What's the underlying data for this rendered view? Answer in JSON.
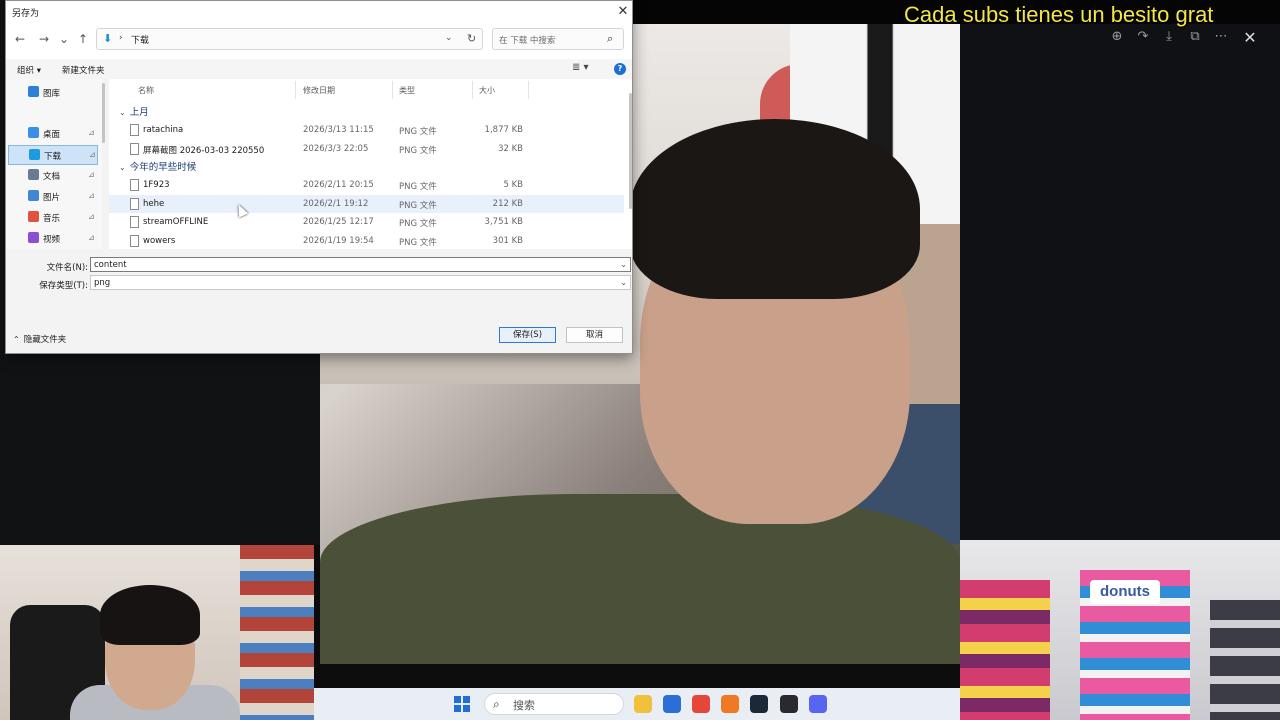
{
  "overlay": {
    "text": "Cada subs tienes un besito grat"
  },
  "dialog": {
    "title": "另存为",
    "close_glyph": "✕",
    "nav": {
      "back": "←",
      "forward": "→",
      "recent": "⌄",
      "up": "↑"
    },
    "address": {
      "icon": "⬇",
      "separator": "›",
      "path": "下载",
      "dropdown": "⌄",
      "refresh": "↻"
    },
    "search": {
      "placeholder": "在 下载 中搜索",
      "icon": "⌕"
    },
    "commands": {
      "organize": "组织 ▾",
      "new_folder": "新建文件夹",
      "view": "≣ ▾",
      "help": "?"
    },
    "nav_pane": {
      "items": [
        {
          "label": "图库",
          "color": "#2d7fd8",
          "pinned": false,
          "selected": false
        },
        {
          "label": "桌面",
          "color": "#3c8fe6",
          "pinned": true,
          "selected": false
        },
        {
          "label": "下载",
          "color": "#1d9be0",
          "pinned": true,
          "selected": true
        },
        {
          "label": "文档",
          "color": "#6a7c93",
          "pinned": true,
          "selected": false
        },
        {
          "label": "图片",
          "color": "#3f86d6",
          "pinned": true,
          "selected": false
        },
        {
          "label": "音乐",
          "color": "#e0533e",
          "pinned": true,
          "selected": false
        },
        {
          "label": "视频",
          "color": "#8a4fd6",
          "pinned": true,
          "selected": false
        }
      ],
      "pin_glyph": "📌"
    },
    "columns": {
      "name": "名称",
      "date": "修改日期",
      "type": "类型",
      "size": "大小"
    },
    "groups": [
      {
        "label": "上月",
        "files": [
          {
            "name": "ratachina",
            "date": "2026/3/13 11:15",
            "type": "PNG 文件",
            "size": "1,877 KB"
          },
          {
            "name": "屏幕截图 2026-03-03 220550",
            "date": "2026/3/3 22:05",
            "type": "PNG 文件",
            "size": "32 KB"
          }
        ]
      },
      {
        "label": "今年的早些时候",
        "files": [
          {
            "name": "1F923",
            "date": "2026/2/11 20:15",
            "type": "PNG 文件",
            "size": "5 KB"
          },
          {
            "name": "hehe",
            "date": "2026/2/1 19:12",
            "type": "PNG 文件",
            "size": "212 KB"
          },
          {
            "name": "streamOFFLINE",
            "date": "2026/1/25 12:17",
            "type": "PNG 文件",
            "size": "3,751 KB"
          },
          {
            "name": "wowers",
            "date": "2026/1/19 19:54",
            "type": "PNG 文件",
            "size": "301 KB"
          }
        ]
      }
    ],
    "group_caret": "⌄",
    "fields": {
      "filename_label": "文件名(N):",
      "filename_value": "content",
      "type_label": "保存类型(T):",
      "type_value": "png",
      "dropdown": "⌄"
    },
    "footer": {
      "hide_folders": "隐藏文件夹",
      "hide_caret": "⌃",
      "save": "保存(S)",
      "cancel": "取消"
    }
  },
  "viewer_tools": [
    "⊕",
    "↷",
    "⤓",
    "⧉",
    "⋯"
  ],
  "viewer_close": "✕",
  "webcam_right": {
    "sign": "donuts"
  },
  "taskbar": {
    "search_icon": "⌕",
    "search_label": "搜索",
    "apps": [
      {
        "name": "file-explorer",
        "color": "#f2c13a"
      },
      {
        "name": "outlook",
        "color": "#2b6fd6"
      },
      {
        "name": "chrome",
        "color": "#e6453a"
      },
      {
        "name": "firefox",
        "color": "#f07a23"
      },
      {
        "name": "steam",
        "color": "#1b2838"
      },
      {
        "name": "obs",
        "color": "#2a2a2e"
      },
      {
        "name": "discord",
        "color": "#5865f2"
      }
    ]
  }
}
